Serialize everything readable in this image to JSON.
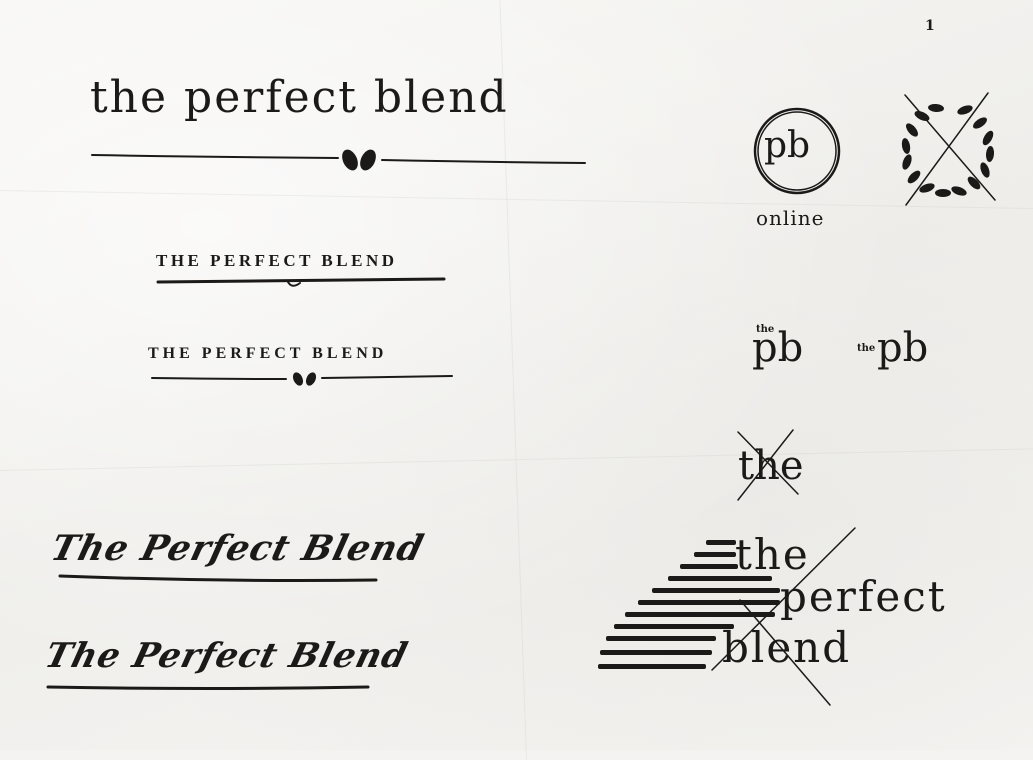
{
  "sketch_1": {
    "text": "the perfect blend"
  },
  "sketch_2": {
    "text": "THE PERFECT BLEND"
  },
  "sketch_3": {
    "text": "THE PERFECT BLEND"
  },
  "script_1": {
    "text": "The Perfect Blend"
  },
  "script_2": {
    "text": "The Perfect Blend"
  },
  "circle_logo": {
    "monogram": "pb",
    "caption": "online"
  },
  "pb_variant_1": {
    "prefix": "the",
    "monogram": "pb"
  },
  "pb_variant_2": {
    "prefix": "the",
    "monogram": "pb"
  },
  "crossed_the": {
    "text": "the"
  },
  "stacked_logo": {
    "line_1": "the",
    "line_2": "perfect",
    "line_3": "blend"
  },
  "corner_mark": {
    "text": "1"
  },
  "colors": {
    "ink": "#1b1a19",
    "paper": "#f4f3f1"
  },
  "icons": [
    "laurel-wreath-icon",
    "coffee-bean-icon",
    "stripe-triangle-icon"
  ]
}
